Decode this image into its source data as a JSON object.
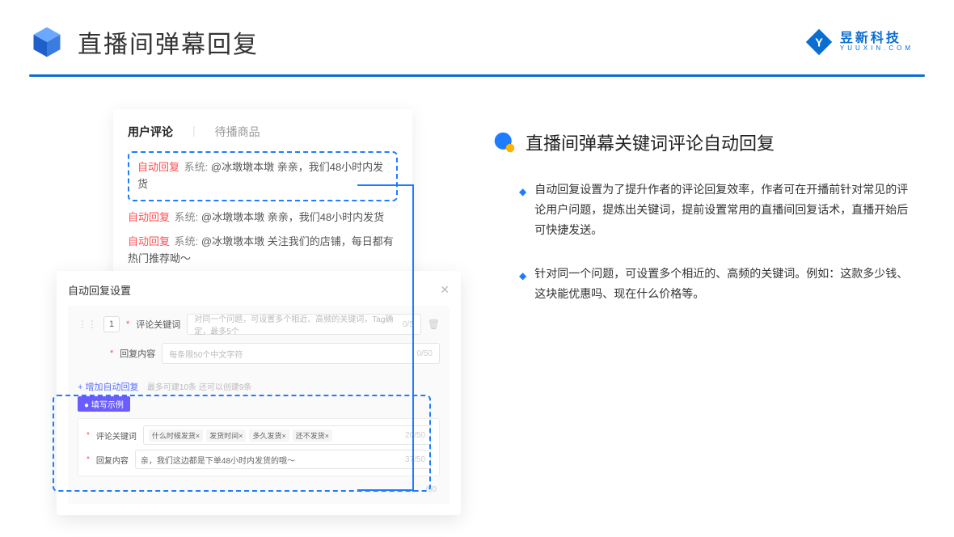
{
  "header": {
    "title": "直播间弹幕回复",
    "logo_cn": "昱新科技",
    "logo_en": "YUUXIN.COM"
  },
  "comments": {
    "tab_active": "用户评论",
    "tab_inactive": "待播商品",
    "rows": [
      {
        "tag": "自动回复",
        "sys": "系统:",
        "at": "@冰墩墩本墩",
        "text": " 亲亲，我们48小时内发货"
      },
      {
        "tag": "自动回复",
        "sys": "系统:",
        "at": "@冰墩墩本墩",
        "text": " 亲亲，我们48小时内发货"
      },
      {
        "tag": "自动回复",
        "sys": "系统:",
        "at": "@冰墩墩本墩",
        "text": " 关注我们的店铺，每日都有热门推荐呦～"
      }
    ]
  },
  "settings": {
    "title": "自动回复设置",
    "num": "1",
    "kw_label": "评论关键词",
    "kw_placeholder": "对同一个问题，可设置多个相近、高频的关键词，Tag确定，最多5个",
    "kw_counter": "0/5",
    "content_label": "回复内容",
    "content_placeholder": "每条限50个中文字符",
    "content_counter": "0/50",
    "add_text": "+ 增加自动回复",
    "add_hint": "最多可建10条 还可以创建9条",
    "example_badge": "● 填写示例",
    "ex_kw_label": "评论关键词",
    "ex_chips": [
      "什么时候发货×",
      "发货时间×",
      "多久发货×",
      "还不发货×"
    ],
    "ex_kw_counter": "20/50",
    "ex_content_label": "回复内容",
    "ex_content_value": "亲，我们这边都是下单48小时内发货的哦～",
    "ex_content_counter": "37/50",
    "bottom_counter": "/50"
  },
  "right": {
    "section_title": "直播间弹幕关键词评论自动回复",
    "bullets": [
      "自动回复设置为了提升作者的评论回复效率，作者可在开播前针对常见的评论用户问题，提炼出关键词，提前设置常用的直播间回复话术，直播开始后可快捷发送。",
      "针对同一个问题，可设置多个相近的、高频的关键词。例如：这款多少钱、这块能优惠吗、现在什么价格等。"
    ]
  }
}
